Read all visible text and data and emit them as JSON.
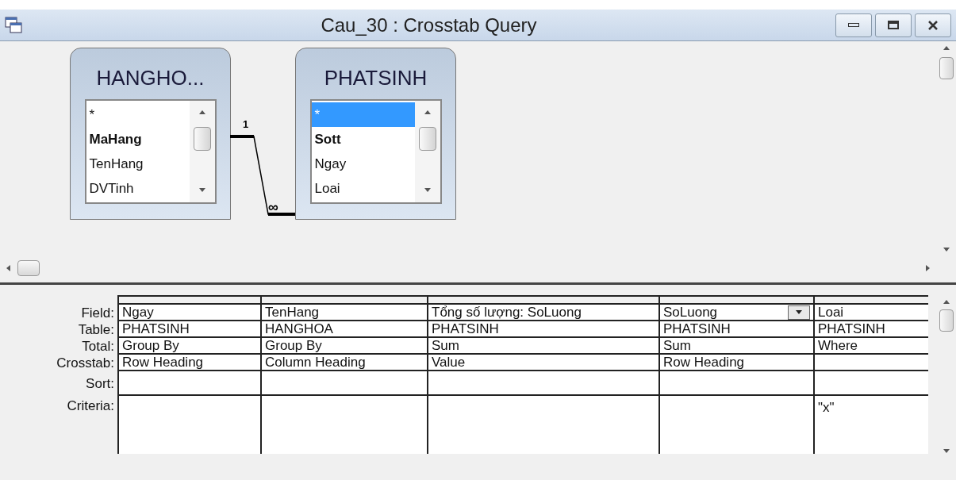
{
  "window": {
    "title": "Cau_30 : Crosstab Query"
  },
  "field_lists": [
    {
      "title": "HANGHO...",
      "fields": [
        {
          "name": "*",
          "bold": false,
          "selected": false
        },
        {
          "name": "MaHang",
          "bold": true,
          "selected": false
        },
        {
          "name": "TenHang",
          "bold": false,
          "selected": false
        },
        {
          "name": "DVTinh",
          "bold": false,
          "selected": false
        }
      ]
    },
    {
      "title": "PHATSINH",
      "fields": [
        {
          "name": "*",
          "bold": false,
          "selected": true
        },
        {
          "name": "Sott",
          "bold": true,
          "selected": false
        },
        {
          "name": "Ngay",
          "bold": false,
          "selected": false
        },
        {
          "name": "Loai",
          "bold": false,
          "selected": false
        }
      ]
    }
  ],
  "relationship": {
    "one_label": "1",
    "many_label": "∞"
  },
  "grid": {
    "row_labels": [
      "Field:",
      "Table:",
      "Total:",
      "Crosstab:",
      "Sort:",
      "Criteria:"
    ],
    "columns": [
      {
        "field": "Ngay",
        "table": "PHATSINH",
        "total": "Group By",
        "crosstab": "Row Heading",
        "dropdown": false
      },
      {
        "field": "TenHang",
        "table": "HANGHOA",
        "total": "Group By",
        "crosstab": "Column Heading",
        "dropdown": false
      },
      {
        "field": "Tổng số lượng: SoLuong",
        "table": "PHATSINH",
        "total": "Sum",
        "crosstab": "Value",
        "dropdown": false
      },
      {
        "field": "SoLuong",
        "table": "PHATSINH",
        "total": "Sum",
        "crosstab": "Row Heading",
        "dropdown": true
      },
      {
        "field": "Loai",
        "table": "PHATSINH",
        "total": "Where",
        "criteria": "\"x\"",
        "dropdown": false
      }
    ]
  }
}
